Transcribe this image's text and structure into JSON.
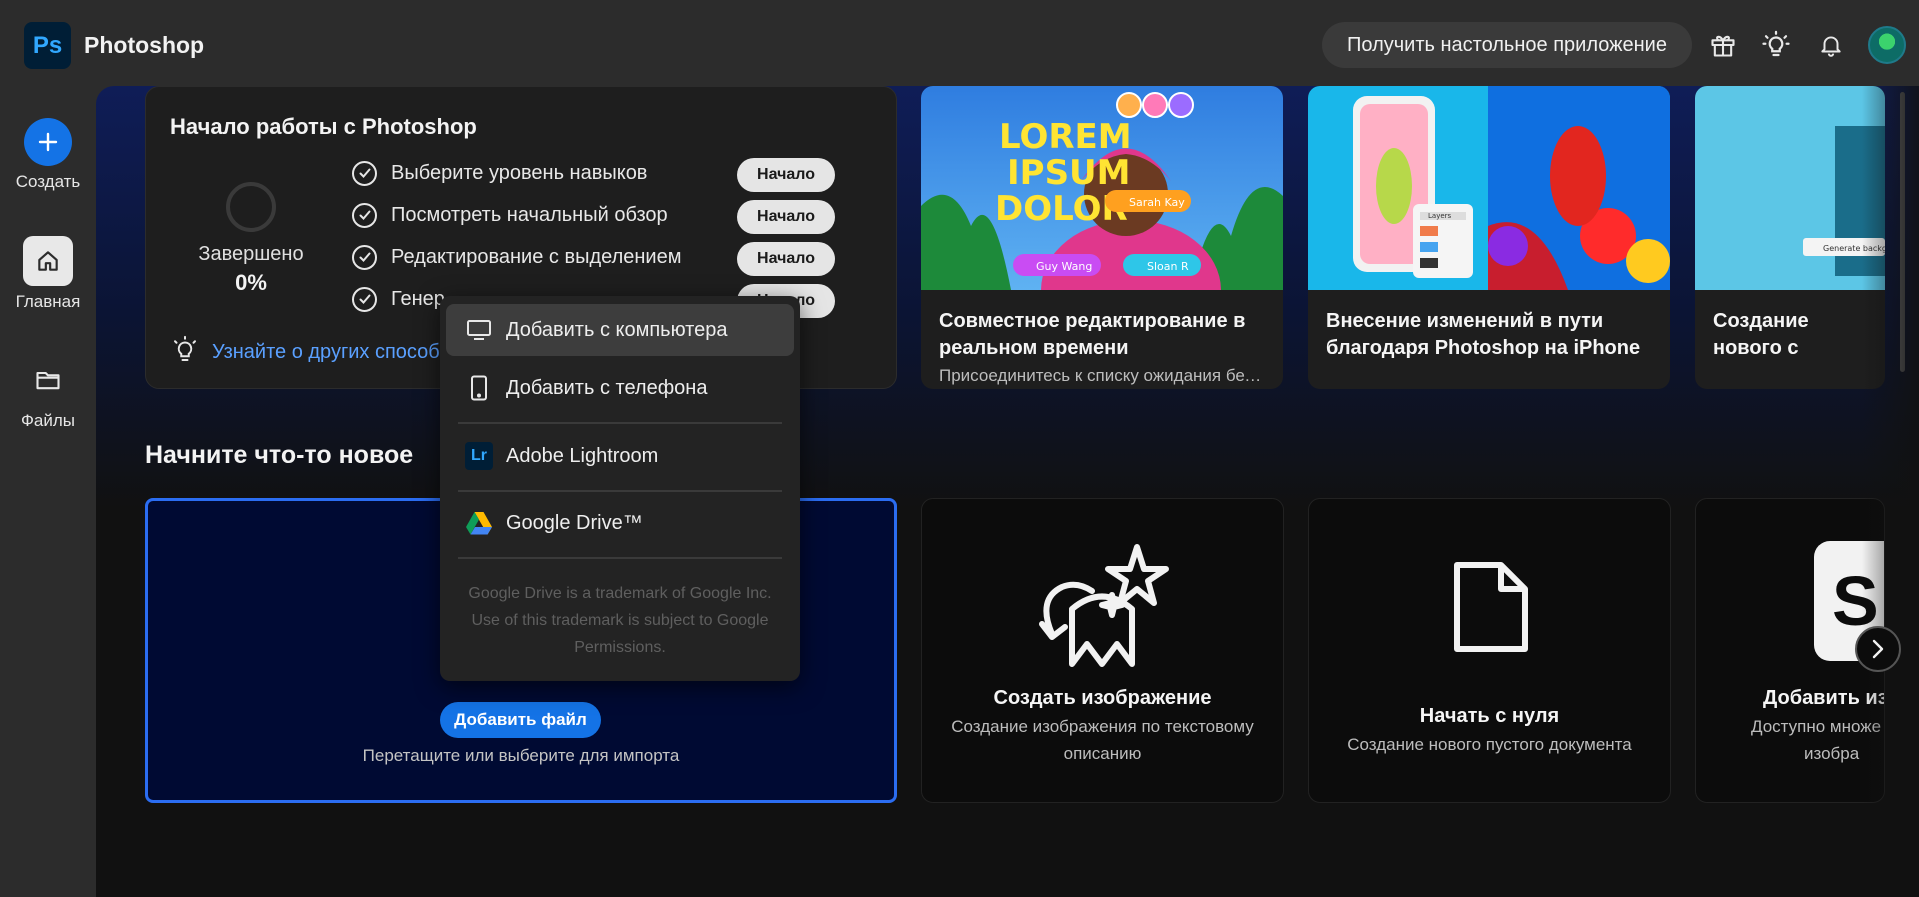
{
  "app": {
    "logo_text": "Ps",
    "title": "Photoshop"
  },
  "topbar": {
    "get_desktop_label": "Получить настольное приложение",
    "icons": [
      "gift-icon",
      "lightbulb-icon",
      "bell-icon",
      "avatar"
    ]
  },
  "rail": {
    "create_label": "Создать",
    "home_label": "Главная",
    "files_label": "Файлы"
  },
  "getting_started": {
    "title": "Начало работы с Photoshop",
    "done_label": "Завершено",
    "done_pct": "0%",
    "tasks": [
      {
        "label": "Выберите уровень навыков",
        "button": "Начало"
      },
      {
        "label": "Посмотреть начальный обзор",
        "button": "Начало"
      },
      {
        "label": "Редактирование с выделением",
        "button": "Начало"
      },
      {
        "label": "Генер",
        "button": "Начало"
      }
    ],
    "learn_more": "Узнайте о других способа"
  },
  "feature_cards": [
    {
      "title": "Совместное редактирование в реальном времени",
      "subtitle": "Присоединитесь к списку ожидания бет…",
      "image_text": {
        "big": "LOREM IPSUM DOLOR",
        "tag1": "Sarah Kay",
        "tag2": "Guy Wang",
        "tag3": "Sloan R"
      }
    },
    {
      "title": "Внесение изменений в пути благодаря Photoshop на iPhone",
      "image_text": {
        "layers": "Layers"
      }
    },
    {
      "title": "Создание нового с",
      "image_text": {
        "chip": "Generate backgrou"
      }
    }
  ],
  "section": {
    "title": "Начните что-то новое"
  },
  "import": {
    "add_file_label": "Добавить файл",
    "hint": "Перетащите или выберите для импорта"
  },
  "new_cards": [
    {
      "title": "Создать изображение",
      "subtitle": "Создание изображения по текстовому описанию"
    },
    {
      "title": "Начать с нуля",
      "subtitle": "Создание нового пустого документа"
    },
    {
      "title": "Добавить из",
      "subtitle_line1": "Доступно множе",
      "subtitle_line2": "изобра",
      "tile_letter": "S"
    }
  ],
  "menu": {
    "items": [
      {
        "label": "Добавить с компьютера",
        "icon": "monitor-icon"
      },
      {
        "label": "Добавить с телефона",
        "icon": "phone-icon"
      },
      {
        "label": "Adobe Lightroom",
        "icon": "lightroom-icon",
        "icon_text": "Lr"
      },
      {
        "label": "Google Drive™",
        "icon": "google-drive-icon"
      }
    ],
    "note": "Google Drive is a trademark of Google Inc. Use of this trademark is subject to Google Permissions."
  },
  "colors": {
    "accent": "#1473e6",
    "link": "#5aa0ff",
    "ps_blue": "#31a8ff",
    "ps_tile": "#001e36",
    "dropzone_border": "#2b6df2"
  }
}
